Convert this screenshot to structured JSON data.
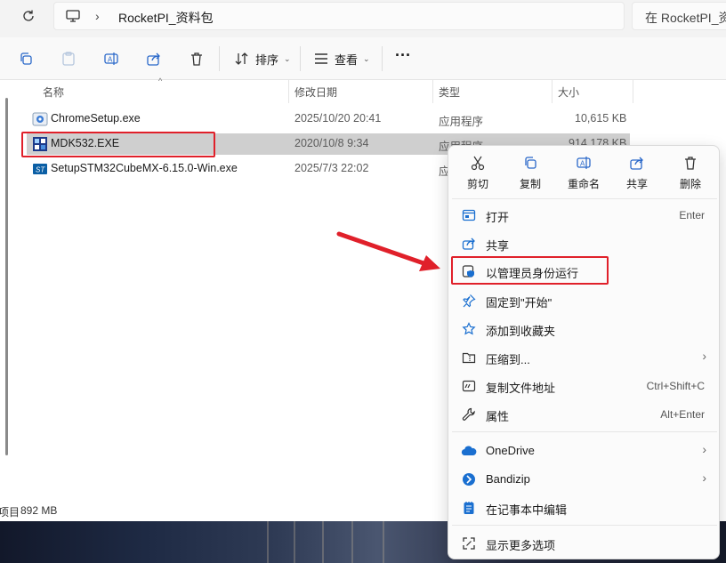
{
  "address": {
    "crumb": "RocketPI_资料包",
    "search_placeholder": "在 RocketPI_资料包 中搜索"
  },
  "toolbar": {
    "sort_label": "排序",
    "view_label": "查看",
    "more_label": "···"
  },
  "columns": {
    "name": "名称",
    "modified": "修改日期",
    "type": "类型",
    "size": "大小"
  },
  "files": [
    {
      "name": "ChromeSetup.exe",
      "modified": "2025/10/20 20:41",
      "type": "应用程序",
      "size": "10,615 KB",
      "icon": "chrome-setup-icon"
    },
    {
      "name": "MDK532.EXE",
      "modified": "2020/10/8 9:34",
      "type": "应用程序",
      "size": "914,178 KB",
      "icon": "mdk-installer-icon"
    },
    {
      "name": "SetupSTM32CubeMX-6.15.0-Win.exe",
      "modified": "2025/7/3 22:02",
      "type": "应",
      "size": "",
      "icon": "st-logo-icon"
    }
  ],
  "status": {
    "items_fragment": "项目",
    "size": "892 MB"
  },
  "context_menu": {
    "quick_actions": [
      {
        "label": "剪切",
        "icon": "scissors-icon"
      },
      {
        "label": "复制",
        "icon": "copy-icon"
      },
      {
        "label": "重命名",
        "icon": "rename-icon"
      },
      {
        "label": "共享",
        "icon": "share-icon"
      },
      {
        "label": "删除",
        "icon": "trash-icon"
      }
    ],
    "open": {
      "label": "打开",
      "shortcut": "Enter"
    },
    "share": {
      "label": "共享"
    },
    "run_as_admin": {
      "label": "以管理员身份运行"
    },
    "pin_start": {
      "label": "固定到\"开始\""
    },
    "add_favorites": {
      "label": "添加到收藏夹"
    },
    "compress": {
      "label": "压缩到..."
    },
    "copy_path": {
      "label": "复制文件地址",
      "shortcut": "Ctrl+Shift+C"
    },
    "properties": {
      "label": "属性",
      "shortcut": "Alt+Enter"
    },
    "onedrive": {
      "label": "OneDrive"
    },
    "bandizip": {
      "label": "Bandizip"
    },
    "notepad": {
      "label": "在记事本中编辑"
    },
    "more_options": {
      "label": "显示更多选项"
    }
  },
  "colors": {
    "highlight_red": "#e0202a",
    "selection_gray": "#cfcfcf",
    "accent_blue": "#1a6fd0"
  }
}
